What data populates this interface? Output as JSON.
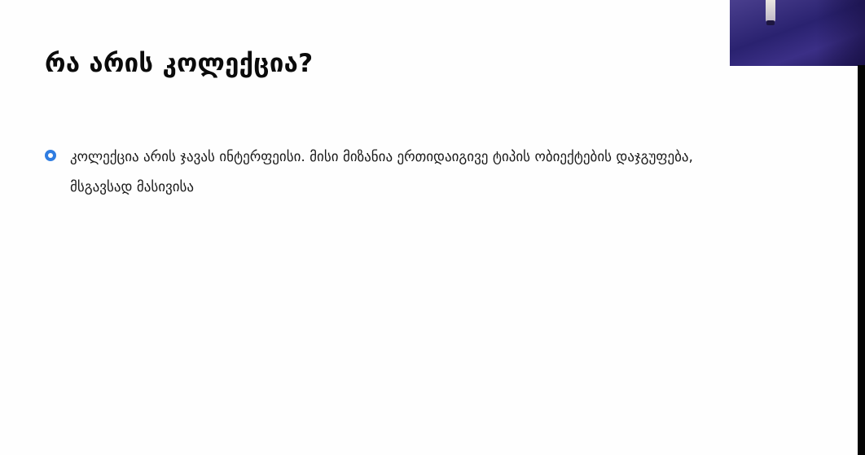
{
  "slide": {
    "title": "რა არის კოლექცია?",
    "bullets": [
      {
        "lines": [
          "კოლექცია არის ჯავას ინტერფეისი. მისი მიზანია ერთიდაიგივე ტიპის ობიექტების დაჯგუფება,",
          "მსგავსად მასივისა"
        ],
        "icon": "radio-bullet-icon"
      }
    ]
  },
  "colors": {
    "bullet_accent": "#2f7de1",
    "title": "#0b0b0b",
    "background": "#fefefe"
  },
  "webcam": {
    "icon": "webcam-feed"
  }
}
